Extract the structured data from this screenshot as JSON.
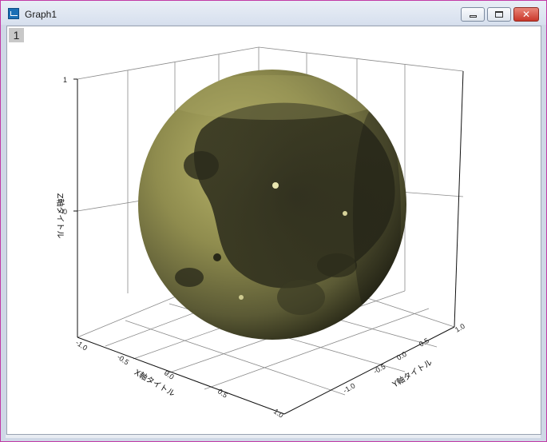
{
  "window": {
    "title": "Graph1",
    "accent_border": "#c23aa6",
    "buttons": {
      "minimize_icon": "minimize-icon",
      "maximize_icon": "maximize-icon",
      "close_icon": "close-icon",
      "close_glyph": "✕"
    }
  },
  "layer": {
    "number": "1"
  },
  "chart_data": {
    "type": "3d-surface",
    "surface": "sphere textured with lunar image",
    "surface_color": "#8f8c4e",
    "z_axis": {
      "title": "Z軸タイトル",
      "ticks": [
        "1",
        "0"
      ]
    },
    "x_axis": {
      "title": "X軸タイトル",
      "ticks": [
        "-1.0",
        "-0.5",
        "0.0",
        "0.5",
        "1.0"
      ]
    },
    "y_axis": {
      "title": "Y軸タイトル",
      "ticks": [
        "-1.0",
        "-0.5",
        "0.0",
        "0.5",
        "1.0"
      ]
    },
    "grid": true
  }
}
